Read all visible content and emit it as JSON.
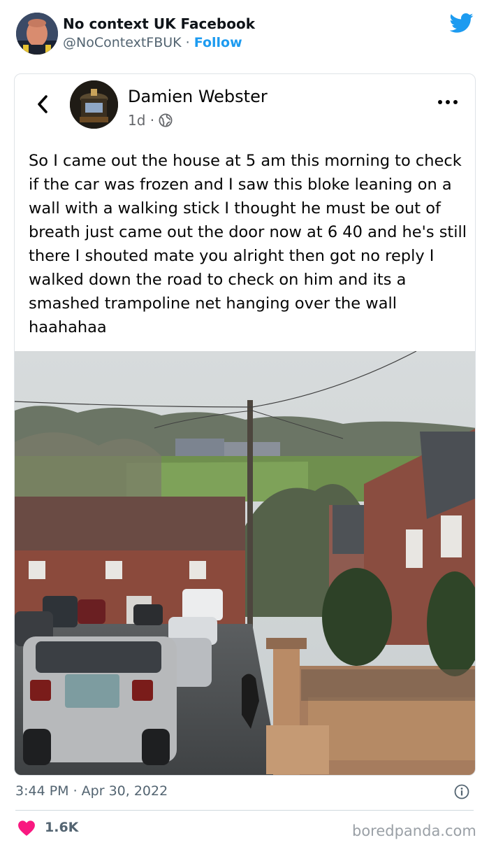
{
  "tweet": {
    "author_name": "No context UK Facebook",
    "handle": "@NoContextFBUK",
    "separator": "·",
    "follow_label": "Follow",
    "timestamp": "3:44 PM · Apr 30, 2022",
    "likes": "1.6K",
    "colors": {
      "accent": "#1d9bf0",
      "heart": "#f91880",
      "secondary": "#536471"
    }
  },
  "fb_post": {
    "author_name": "Damien Webster",
    "age": "1d ·",
    "body": "So I came out the house at 5 am this morning to check if the car was frozen and I saw this bloke leaning on a wall with a walking stick I thought he must be out of breath just came out the door now at 6 40 and he's still there I shouted mate you alright then got no reply I walked down the road to check on him and its a smashed trampoline net hanging over the wall haahahaa",
    "icons": [
      "back-arrow-icon",
      "globe-icon",
      "more-options-icon"
    ]
  },
  "watermark": "boredpanda.com"
}
